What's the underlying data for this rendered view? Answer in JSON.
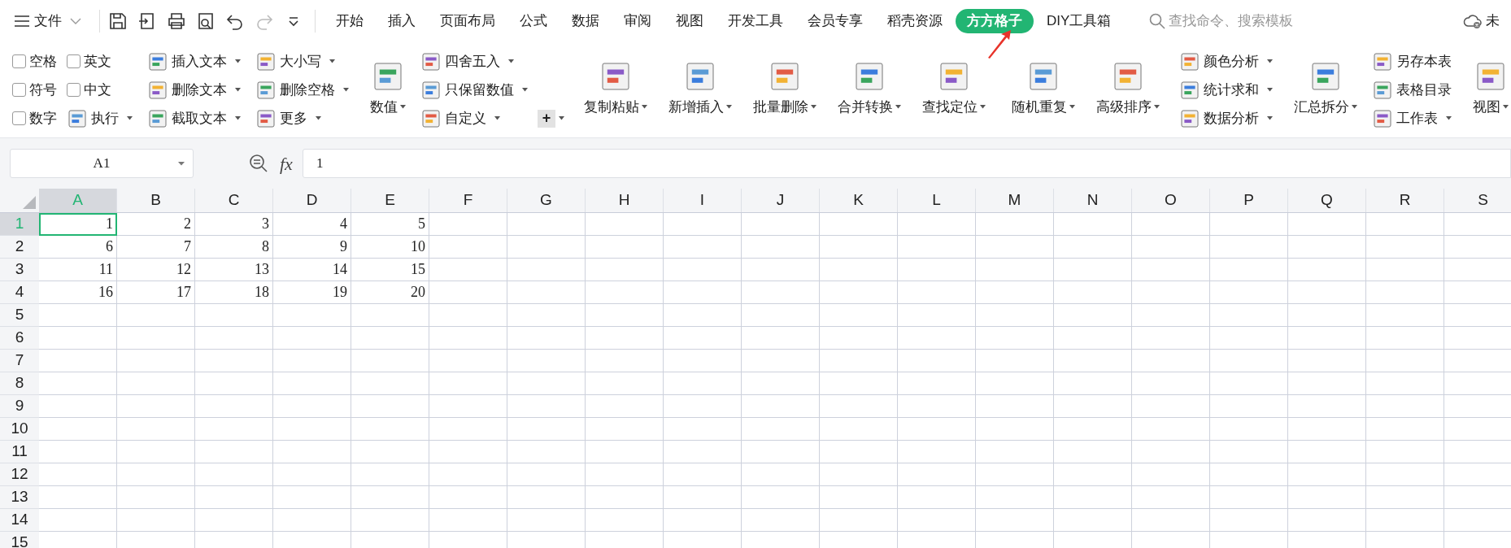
{
  "top_bar": {
    "file_menu": "文件",
    "tabs": [
      {
        "label": "开始",
        "selected": false
      },
      {
        "label": "插入",
        "selected": false
      },
      {
        "label": "页面布局",
        "selected": false
      },
      {
        "label": "公式",
        "selected": false
      },
      {
        "label": "数据",
        "selected": false
      },
      {
        "label": "审阅",
        "selected": false
      },
      {
        "label": "视图",
        "selected": false
      },
      {
        "label": "开发工具",
        "selected": false
      },
      {
        "label": "会员专享",
        "selected": false
      },
      {
        "label": "稻壳资源",
        "selected": false
      },
      {
        "label": "方方格子",
        "selected": true
      },
      {
        "label": "DIY工具箱",
        "selected": false
      }
    ],
    "search": {
      "placeholder": "查找命令、搜索模板"
    },
    "cloud_status": "未"
  },
  "ribbon": {
    "groups": [
      {
        "items": [
          {
            "kind": "checkbox",
            "label": "空格",
            "checked": false
          },
          {
            "kind": "checkbox",
            "label": "符号",
            "checked": false
          },
          {
            "kind": "checkbox",
            "label": "数字",
            "checked": false
          },
          {
            "kind": "checkbox",
            "label": "英文",
            "checked": false
          },
          {
            "kind": "checkbox",
            "label": "中文",
            "checked": false
          },
          {
            "kind": "small",
            "label": "执行",
            "dropdown": true
          }
        ]
      },
      {
        "items": [
          {
            "kind": "small",
            "label": "插入文本",
            "dropdown": true
          },
          {
            "kind": "small",
            "label": "删除文本",
            "dropdown": true
          },
          {
            "kind": "small",
            "label": "截取文本",
            "dropdown": true
          }
        ]
      },
      {
        "items": [
          {
            "kind": "small",
            "label": "大小写",
            "dropdown": true
          },
          {
            "kind": "small",
            "label": "删除空格",
            "dropdown": true
          },
          {
            "kind": "small",
            "label": "更多",
            "dropdown": true
          }
        ]
      },
      {
        "items": [
          {
            "kind": "large",
            "label": "数值",
            "dropdown": true
          },
          {
            "kind": "small",
            "label": "四舍五入",
            "dropdown": true
          },
          {
            "kind": "small",
            "label": "只保留数值",
            "dropdown": true
          },
          {
            "kind": "small",
            "label": "自定义",
            "dropdown": true
          },
          {
            "kind": "plus",
            "label": "+",
            "dropdown": true
          }
        ]
      },
      {
        "items": [
          {
            "kind": "large",
            "label": "复制粘贴",
            "dropdown": true
          },
          {
            "kind": "large",
            "label": "新增插入",
            "dropdown": true
          },
          {
            "kind": "large",
            "label": "批量删除",
            "dropdown": true
          },
          {
            "kind": "large",
            "label": "合并转换",
            "dropdown": true
          },
          {
            "kind": "large",
            "label": "查找定位",
            "dropdown": true
          }
        ]
      },
      {
        "items": [
          {
            "kind": "large",
            "label": "随机重复",
            "dropdown": true
          },
          {
            "kind": "large",
            "label": "高级排序",
            "dropdown": true
          }
        ]
      },
      {
        "items": [
          {
            "kind": "small",
            "label": "颜色分析",
            "dropdown": true
          },
          {
            "kind": "small",
            "label": "统计求和",
            "dropdown": true
          },
          {
            "kind": "small",
            "label": "数据分析",
            "dropdown": true
          }
        ]
      },
      {
        "items": [
          {
            "kind": "large",
            "label": "汇总拆分",
            "dropdown": true
          },
          {
            "kind": "small",
            "label": "另存本表",
            "dropdown": false
          },
          {
            "kind": "small",
            "label": "表格目录",
            "dropdown": false
          },
          {
            "kind": "small",
            "label": "工作表",
            "dropdown": true
          }
        ]
      },
      {
        "items": [
          {
            "kind": "large",
            "label": "视图",
            "dropdown": true
          }
        ]
      }
    ]
  },
  "formula_bar": {
    "name_box": "A1",
    "function_label": "fx",
    "formula": "1"
  },
  "sheet": {
    "columns": [
      {
        "label": "A",
        "selected": true
      },
      {
        "label": "B",
        "selected": false
      },
      {
        "label": "C",
        "selected": false
      },
      {
        "label": "D",
        "selected": false
      },
      {
        "label": "E",
        "selected": false
      },
      {
        "label": "F",
        "selected": false
      },
      {
        "label": "G",
        "selected": false
      },
      {
        "label": "H",
        "selected": false
      },
      {
        "label": "I",
        "selected": false
      },
      {
        "label": "J",
        "selected": false
      },
      {
        "label": "K",
        "selected": false
      },
      {
        "label": "L",
        "selected": false
      },
      {
        "label": "M",
        "selected": false
      },
      {
        "label": "N",
        "selected": false
      },
      {
        "label": "O",
        "selected": false
      },
      {
        "label": "P",
        "selected": false
      },
      {
        "label": "Q",
        "selected": false
      },
      {
        "label": "R",
        "selected": false
      },
      {
        "label": "S",
        "selected": false
      }
    ],
    "rows": [
      {
        "label": "1",
        "selected": true,
        "cells": [
          {
            "value": "1",
            "selected": true
          },
          {
            "value": "2",
            "selected": false
          },
          {
            "value": "3",
            "selected": false
          },
          {
            "value": "4",
            "selected": false
          },
          {
            "value": "5",
            "selected": false
          }
        ]
      },
      {
        "label": "2",
        "selected": false,
        "cells": [
          {
            "value": "6",
            "selected": false
          },
          {
            "value": "7",
            "selected": false
          },
          {
            "value": "8",
            "selected": false
          },
          {
            "value": "9",
            "selected": false
          },
          {
            "value": "10",
            "selected": false
          }
        ]
      },
      {
        "label": "3",
        "selected": false,
        "cells": [
          {
            "value": "11",
            "selected": false
          },
          {
            "value": "12",
            "selected": false
          },
          {
            "value": "13",
            "selected": false
          },
          {
            "value": "14",
            "selected": false
          },
          {
            "value": "15",
            "selected": false
          }
        ]
      },
      {
        "label": "4",
        "selected": false,
        "cells": [
          {
            "value": "16",
            "selected": false
          },
          {
            "value": "17",
            "selected": false
          },
          {
            "value": "18",
            "selected": false
          },
          {
            "value": "19",
            "selected": false
          },
          {
            "value": "20",
            "selected": false
          }
        ]
      },
      {
        "label": "5",
        "selected": false
      },
      {
        "label": "6",
        "selected": false
      },
      {
        "label": "7",
        "selected": false
      },
      {
        "label": "8",
        "selected": false
      },
      {
        "label": "9",
        "selected": false
      },
      {
        "label": "10",
        "selected": false
      },
      {
        "label": "11",
        "selected": false
      },
      {
        "label": "12",
        "selected": false
      },
      {
        "label": "13",
        "selected": false
      },
      {
        "label": "14",
        "selected": false
      },
      {
        "label": "15",
        "selected": false
      }
    ]
  }
}
